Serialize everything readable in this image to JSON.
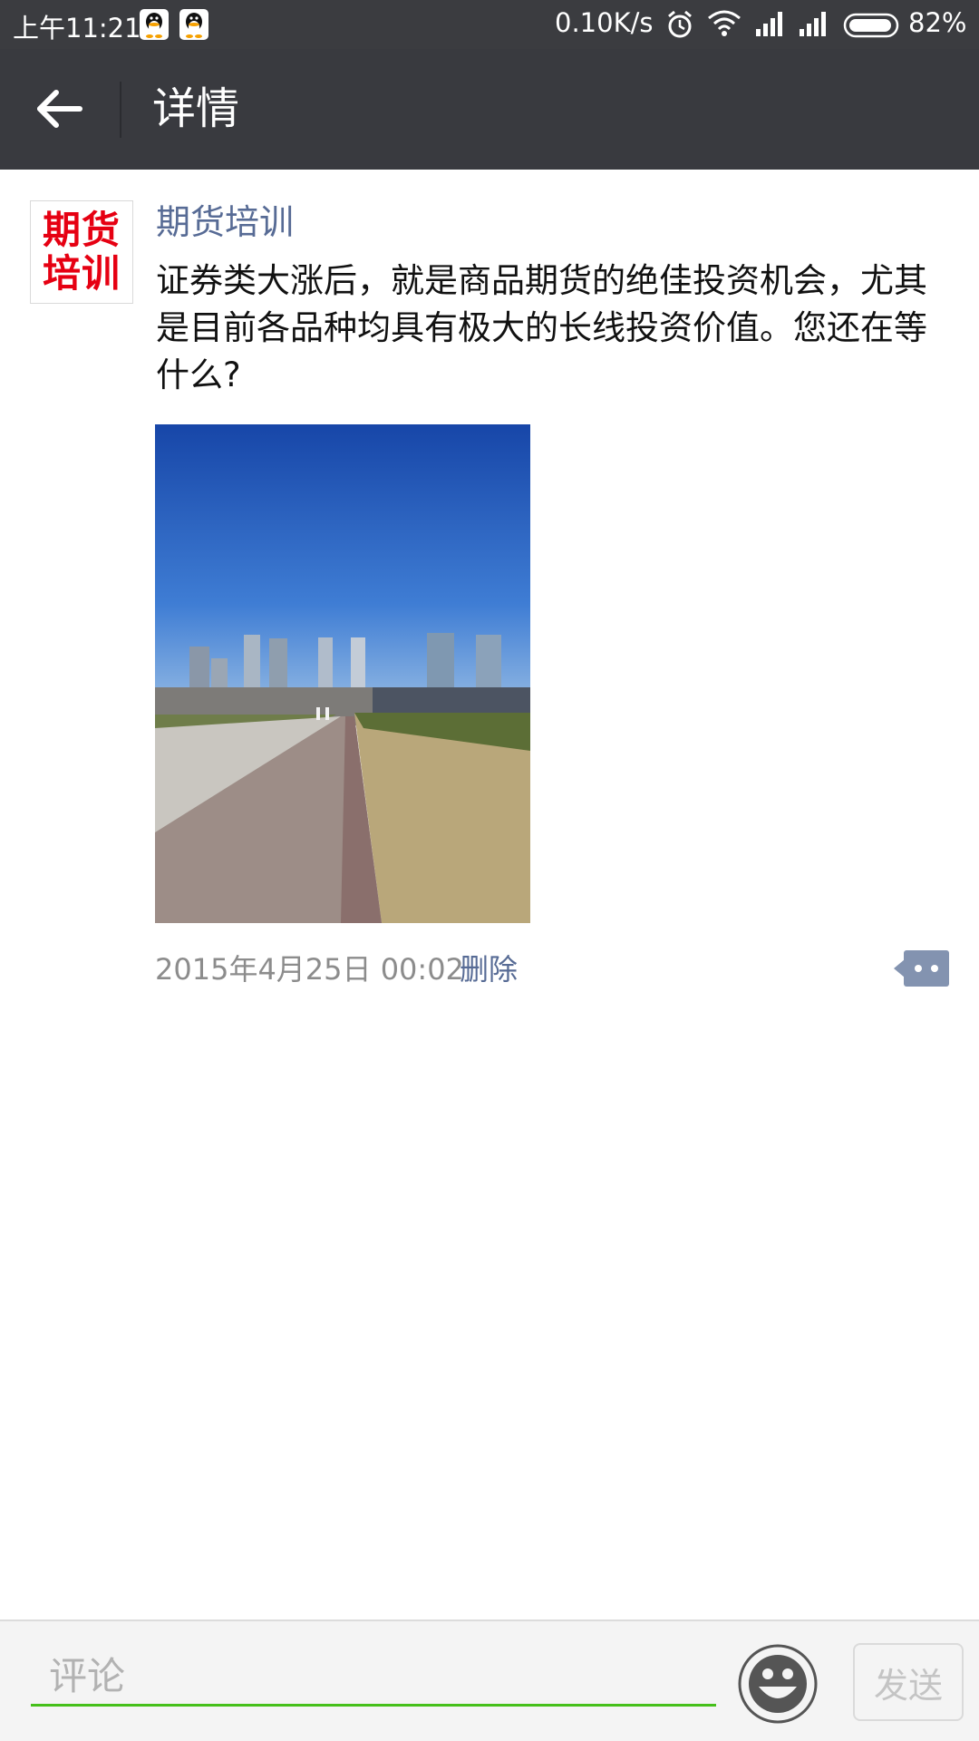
{
  "status_bar": {
    "time": "上午11:21",
    "net_speed": "0.10K/s",
    "battery": "82%",
    "icons": [
      "qq-icon",
      "qq-icon",
      "alarm-icon",
      "wifi-icon",
      "signal-icon",
      "signal-icon",
      "battery-icon"
    ]
  },
  "header": {
    "title": "详情",
    "back_icon": "arrow-left-icon"
  },
  "post": {
    "avatar_lines": [
      "期货",
      "培训"
    ],
    "author": "期货培训",
    "content": "证券类大涨后，就是商品期货的绝佳投资机会，尤其是目前各品种均具有极大的长线投资价值。您还在等什么?",
    "image": "city-plaza-skyline-photo",
    "timestamp": "2015年4月25日 00:02",
    "delete_label": "删除",
    "more_icon": "comment-more-icon"
  },
  "comment_bar": {
    "placeholder": "评论",
    "value": "",
    "emoji_icon": "smiley-icon",
    "send_label": "发送"
  },
  "colors": {
    "title_bar": "#393a3f",
    "status_bar": "#3b3c40",
    "link": "#576b95",
    "input_underline": "#45c01a",
    "avatar_text": "#e60012"
  }
}
